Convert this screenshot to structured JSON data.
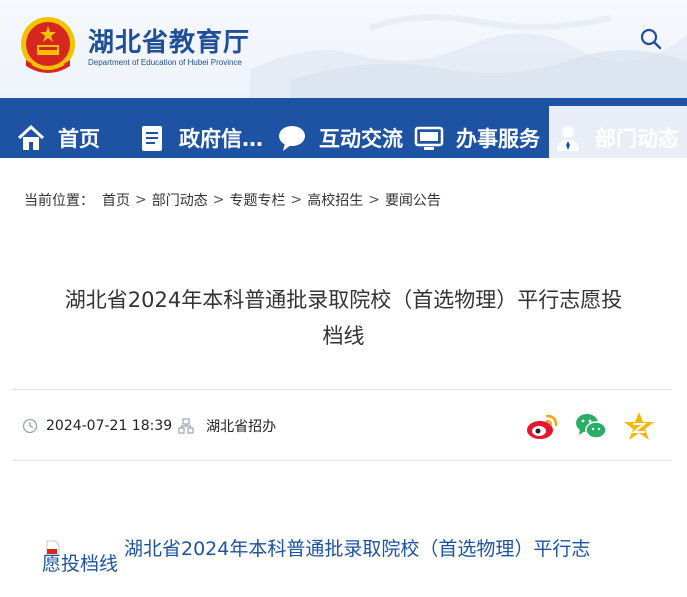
{
  "header": {
    "title": "湖北省教育厅",
    "subtitle": "Department of Education of Hubei Province"
  },
  "nav": {
    "items": [
      {
        "label": "首页",
        "icon": "home-icon"
      },
      {
        "label": "政府信…",
        "icon": "document-icon"
      },
      {
        "label": "互动交流",
        "icon": "chat-bubble-icon"
      },
      {
        "label": "办事服务",
        "icon": "monitor-icon"
      },
      {
        "label": "部门动态",
        "icon": "person-icon"
      }
    ]
  },
  "breadcrumb": {
    "prefix": "当前位置：",
    "items": [
      "首页",
      "部门动态",
      "专题专栏",
      "高校招生",
      "要闻公告"
    ],
    "separator": ">"
  },
  "article": {
    "title_line1": "湖北省2024年本科普通批录取院校（首选物理）平行志愿投",
    "title_line2": "档线",
    "date": "2024-07-21 18:39",
    "source": "湖北省招办"
  },
  "attachment": {
    "line1": "湖北省2024年本科普通批录取院校（首选物理）平行志",
    "line2": "愿投档线"
  },
  "colors": {
    "nav_bg": "#1e53a4",
    "title_blue": "#1f4f99",
    "weibo": "#e6162d",
    "wechat": "#2aae67",
    "qzone": "#f5b800"
  }
}
